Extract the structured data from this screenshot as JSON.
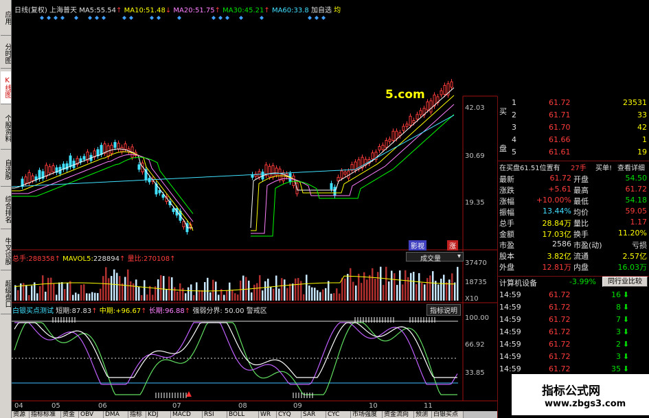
{
  "left_tabs": [
    {
      "label": "应用",
      "active": false
    },
    {
      "label": "分时图",
      "active": false
    },
    {
      "label": "K线图",
      "active": true
    },
    {
      "label": "个股资料",
      "active": false
    },
    {
      "label": "自选股",
      "active": false
    },
    {
      "label": "综合排名",
      "active": false
    },
    {
      "label": "牛叉诊股",
      "active": false
    },
    {
      "label": "超级盘口",
      "active": false
    }
  ],
  "header": {
    "title": "日线(复权)",
    "stock": "上海普天",
    "ma5_label": "MA5:",
    "ma5": "55.54",
    "ma10_label": "MA10:",
    "ma10": "51.48",
    "ma20_label": "MA20:",
    "ma20": "51.75",
    "ma30_label": "MA30:",
    "ma30": "45.21",
    "ma60_label": "MA60:",
    "ma60": "33.8",
    "add_fav": "加自选",
    "extra": "均"
  },
  "price_axis": [
    "42.03",
    "30.69",
    "19.35"
  ],
  "chart_overlay_text": "5.com",
  "main_tags": {
    "tag1": "影视",
    "tag2": "涨"
  },
  "volume_header": {
    "total_label": "总手:",
    "total": "288358",
    "mavol_label": "MAVOL5:",
    "mavol": "228894",
    "ratio_label": "量比:",
    "ratio": "270108",
    "dropdown": "成交量"
  },
  "volume_axis": [
    "37470",
    "18735",
    "X10"
  ],
  "indicator_header": {
    "name": "白银买点测试",
    "short_label": "短期:",
    "short": "87.83",
    "mid_label": "中期:",
    "mid": "+96.67",
    "long_label": "长期:",
    "long": "96.88",
    "boundary": "强弱分界: 50.00 警戒区",
    "help": "指标说明"
  },
  "indicator_axis": [
    "100.00",
    "66.92",
    "33.85"
  ],
  "months": [
    "04",
    "05",
    "06",
    "07",
    "08",
    "09",
    "10",
    "11"
  ],
  "order_book": [
    {
      "side": "买",
      "level": "1",
      "price": "61.72",
      "vol": "23531"
    },
    {
      "side": "",
      "level": "2",
      "price": "61.71",
      "vol": "33"
    },
    {
      "side": "",
      "level": "3",
      "price": "61.70",
      "vol": "42"
    },
    {
      "side": "盘",
      "level": "4",
      "price": "61.66",
      "vol": "1"
    },
    {
      "side": "",
      "level": "5",
      "price": "61.61",
      "vol": "19"
    }
  ],
  "bid_position": {
    "text": "在买盘61.51位置有",
    "count": "27手",
    "buy_label": "买单!",
    "details": "查看详细"
  },
  "quote": [
    {
      "l1": "最新",
      "v1": "61.72",
      "l2": "开盘",
      "v2": "54.50",
      "c1": "red",
      "c2": "grn"
    },
    {
      "l1": "涨跌",
      "v1": "+5.61",
      "l2": "最高",
      "v2": "61.72",
      "c1": "red",
      "c2": "red"
    },
    {
      "l1": "涨幅",
      "v1": "+10.00%",
      "l2": "最低",
      "v2": "54.18",
      "c1": "red",
      "c2": "grn"
    },
    {
      "l1": "振幅",
      "v1": "13.44%",
      "l2": "均价",
      "v2": "59.05",
      "c1": "cyn",
      "c2": "red"
    },
    {
      "l1": "总手",
      "v1": "28.84万",
      "l2": "量比",
      "v2": "1.17",
      "c1": "yel",
      "c2": "red"
    },
    {
      "l1": "金额",
      "v1": "17.03亿",
      "l2": "换手",
      "v2": "11.20%",
      "c1": "yel",
      "c2": "yel"
    },
    {
      "l1": "市盈",
      "v1": "2586",
      "l2": "市盈(动)",
      "v2": "亏损",
      "c1": "wht",
      "c2": "wht"
    },
    {
      "l1": "股本",
      "v1": "3.82亿",
      "l2": "流通",
      "v2": "2.57亿",
      "c1": "yel",
      "c2": "yel"
    },
    {
      "l1": "外盘",
      "v1": "12.81万",
      "l2": "内盘",
      "v2": "16.03万",
      "c1": "red",
      "c2": "grn"
    }
  ],
  "sector": {
    "name": "计算机设备",
    "change": "-3.99%",
    "compare": "同行业比较"
  },
  "ticks": [
    {
      "time": "14:59",
      "price": "61.72",
      "vol": "16",
      "dir": "down"
    },
    {
      "time": "14:59",
      "price": "61.72",
      "vol": "8",
      "dir": "down"
    },
    {
      "time": "14:59",
      "price": "61.72",
      "vol": "7",
      "dir": "down"
    },
    {
      "time": "14:59",
      "price": "61.72",
      "vol": "3",
      "dir": "down"
    },
    {
      "time": "14:59",
      "price": "61.72",
      "vol": "2",
      "dir": "down"
    },
    {
      "time": "14:59",
      "price": "61.72",
      "vol": "3",
      "dir": "down"
    },
    {
      "time": "14:59",
      "price": "61.72",
      "vol": "35",
      "dir": "down"
    }
  ],
  "bottom_tabs": [
    "资源",
    "指标标准",
    "资金",
    "OBV",
    "DMA",
    "指标",
    "KDJ",
    "MACD",
    "RSI",
    "BOLL",
    "WR",
    "CYQ",
    "SAR",
    "CYC",
    "市场强度",
    "资金流向",
    "预测",
    "白银买点"
  ],
  "watermark": {
    "line1": "指标公式网",
    "line2": "www.zbgs3.com"
  },
  "colors": {
    "up": "#ff3c3c",
    "down": "#40e0ff",
    "ma5": "#ffffff",
    "ma10": "#ffff00",
    "ma20": "#ff80ff",
    "ma30": "#00ff00",
    "ma60": "#40e0ff",
    "frame": "#a01010"
  }
}
